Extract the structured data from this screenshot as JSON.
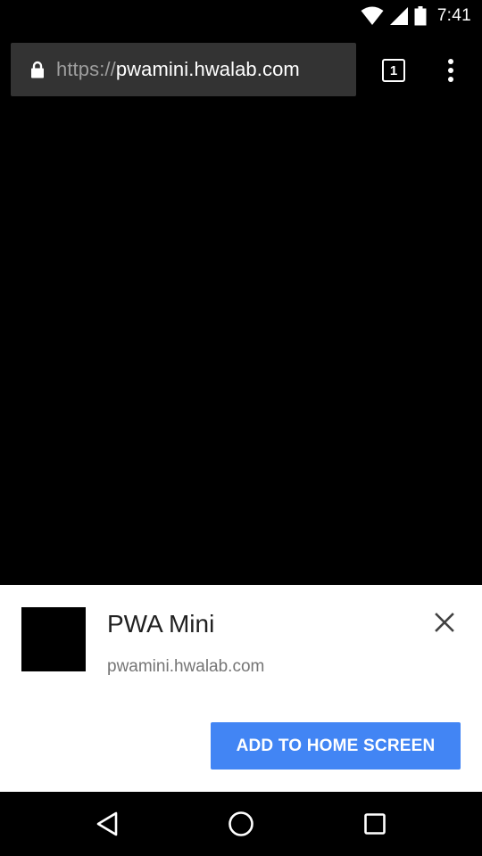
{
  "status_bar": {
    "time": "7:41",
    "icons": [
      "wifi-icon",
      "cell-signal-icon",
      "battery-icon"
    ]
  },
  "toolbar": {
    "url_scheme": "https://",
    "url_host": "pwamini.hwalab.com",
    "tab_count": "1",
    "icons": [
      "lock-icon",
      "tab-switcher-icon",
      "overflow-menu-icon"
    ]
  },
  "install_banner": {
    "app_name": "PWA Mini",
    "app_url": "pwamini.hwalab.com",
    "add_button_label": "ADD TO HOME SCREEN",
    "button_color": "#4285f4",
    "icons": [
      "app-icon",
      "close-icon"
    ]
  },
  "nav_bar": {
    "icons": [
      "back-icon",
      "home-icon",
      "recents-icon"
    ]
  },
  "colors": {
    "background": "#000000",
    "url_bar": "#333333",
    "banner": "#ffffff",
    "accent": "#4285f4"
  }
}
